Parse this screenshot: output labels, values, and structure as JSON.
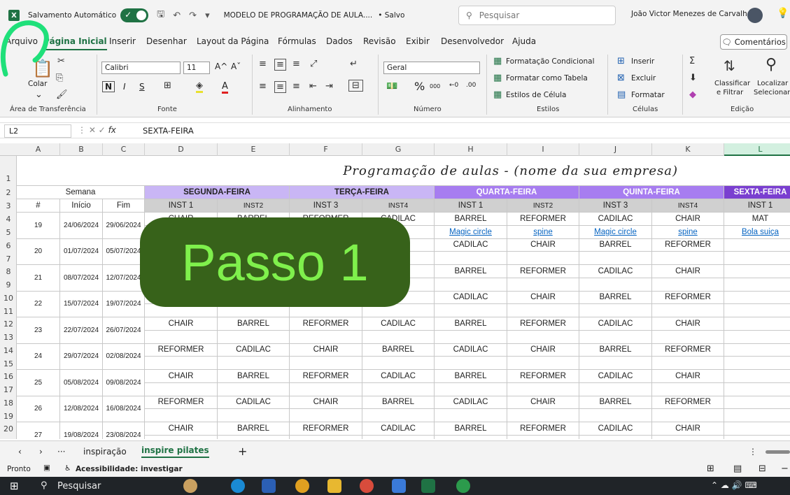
{
  "titlebar": {
    "autosave_label": "Salvamento Automático",
    "doc_title": "MODELO DE PROGRAMAÇÃO DE AULA....",
    "save_status": "• Salvo",
    "search_placeholder": "Pesquisar",
    "user_name": "João Victor Menezes de Carvalho"
  },
  "menu": {
    "tabs": [
      "Arquivo",
      "Página Inicial",
      "Inserir",
      "Desenhar",
      "Layout da Página",
      "Fórmulas",
      "Dados",
      "Revisão",
      "Exibir",
      "Desenvolvedor",
      "Ajuda"
    ],
    "active": "Página Inicial",
    "comments": "Comentários"
  },
  "ribbon": {
    "paste": "Colar",
    "clipboard_group": "Área de Transferência",
    "font_name": "Calibri",
    "font_size": "11",
    "font_group": "Fonte",
    "align_group": "Alinhamento",
    "number_format": "Geral",
    "number_group": "Número",
    "cond_format": "Formatação Condicional",
    "format_table": "Formatar como Tabela",
    "cell_styles": "Estilos de Célula",
    "styles_group": "Estilos",
    "insert": "Inserir",
    "delete": "Excluir",
    "format": "Formatar",
    "cells_group": "Células",
    "sort_1": "Classificar",
    "sort_2": "e Filtrar",
    "find_1": "Localizar",
    "find_2": "Selecionar",
    "edit_group": "Edição"
  },
  "formula_bar": {
    "cell_ref": "L2",
    "formula": "SEXTA-FEIRA"
  },
  "sheet": {
    "columns": [
      "A",
      "B",
      "C",
      "D",
      "E",
      "F",
      "G",
      "H",
      "I",
      "J",
      "K",
      "L"
    ],
    "selected_column": "L",
    "rows": [
      "1",
      "2",
      "3",
      "4",
      "5",
      "6",
      "7",
      "8",
      "9",
      "10",
      "11",
      "12",
      "13",
      "14",
      "15",
      "16",
      "17",
      "18",
      "19",
      "20"
    ],
    "title": "Programação de aulas - (nome da sua empresa)",
    "semana_header": "Semana",
    "days": [
      "SEGUNDA-FEIRA",
      "TERÇA-FEIRA",
      "QUARTA-FEIRA",
      "QUINTA-FEIRA",
      "SEXTA-FEIRA"
    ],
    "day_colors": [
      "#c9b6f5",
      "#c9b6f5",
      "#a77df0",
      "#a77df0",
      "#7a3fd0"
    ],
    "sub_headers": [
      "#",
      "Início",
      "Fim",
      "INST 1",
      "INST2",
      "INST 3",
      "INST4",
      "INST 1",
      "INST2",
      "INST 3",
      "INST4",
      "INST 1"
    ],
    "weeks": [
      {
        "num": "19",
        "start": "24/06/2024",
        "end": "29/06/2024",
        "a": [
          "CHAIR",
          "BARREL",
          "REFORMER",
          "CADILAC",
          "BARREL",
          "REFORMER",
          "CADILAC",
          "CHAIR",
          "MAT"
        ],
        "b": [
          "",
          "",
          "",
          "",
          "Magic circle",
          "spine",
          "Magic circle",
          "spine",
          "Bola suiça"
        ]
      },
      {
        "num": "20",
        "start": "01/07/2024",
        "end": "05/07/2024",
        "a": [
          "",
          "",
          "",
          "",
          "CADILAC",
          "CHAIR",
          "BARREL",
          "REFORMER",
          ""
        ],
        "b": [
          "",
          "",
          "",
          "",
          "",
          "",
          "",
          "",
          ""
        ]
      },
      {
        "num": "21",
        "start": "08/07/2024",
        "end": "12/07/2024",
        "a": [
          "",
          "",
          "",
          "",
          "BARREL",
          "REFORMER",
          "CADILAC",
          "CHAIR",
          ""
        ],
        "b": [
          "",
          "",
          "",
          "",
          "",
          "",
          "",
          "",
          ""
        ]
      },
      {
        "num": "22",
        "start": "15/07/2024",
        "end": "19/07/2024",
        "a": [
          "",
          "",
          "",
          "",
          "CADILAC",
          "CHAIR",
          "BARREL",
          "REFORMER",
          ""
        ],
        "b": [
          "",
          "",
          "",
          "",
          "",
          "",
          "",
          "",
          ""
        ]
      },
      {
        "num": "23",
        "start": "22/07/2024",
        "end": "26/07/2024",
        "a": [
          "CHAIR",
          "BARREL",
          "REFORMER",
          "CADILAC",
          "BARREL",
          "REFORMER",
          "CADILAC",
          "CHAIR",
          ""
        ],
        "b": [
          "",
          "",
          "",
          "",
          "",
          "",
          "",
          "",
          ""
        ]
      },
      {
        "num": "24",
        "start": "29/07/2024",
        "end": "02/08/2024",
        "a": [
          "REFORMER",
          "CADILAC",
          "CHAIR",
          "BARREL",
          "CADILAC",
          "CHAIR",
          "BARREL",
          "REFORMER",
          ""
        ],
        "b": [
          "",
          "",
          "",
          "",
          "",
          "",
          "",
          "",
          ""
        ]
      },
      {
        "num": "25",
        "start": "05/08/2024",
        "end": "09/08/2024",
        "a": [
          "CHAIR",
          "BARREL",
          "REFORMER",
          "CADILAC",
          "BARREL",
          "REFORMER",
          "CADILAC",
          "CHAIR",
          ""
        ],
        "b": [
          "",
          "",
          "",
          "",
          "",
          "",
          "",
          "",
          ""
        ]
      },
      {
        "num": "26",
        "start": "12/08/2024",
        "end": "16/08/2024",
        "a": [
          "REFORMER",
          "CADILAC",
          "CHAIR",
          "BARREL",
          "CADILAC",
          "CHAIR",
          "BARREL",
          "REFORMER",
          ""
        ],
        "b": [
          "",
          "",
          "",
          "",
          "",
          "",
          "",
          "",
          ""
        ]
      },
      {
        "num": "27",
        "start": "19/08/2024",
        "end": "23/08/2024",
        "a": [
          "CHAIR",
          "BARREL",
          "REFORMER",
          "CADILAC",
          "BARREL",
          "REFORMER",
          "CADILAC",
          "CHAIR",
          ""
        ],
        "b": [
          "",
          "",
          "",
          "",
          "",
          "",
          "",
          "",
          ""
        ]
      }
    ]
  },
  "overlay": {
    "text": "Passo 1"
  },
  "sheet_tabs": {
    "more": "···",
    "tab_1": "inspiração",
    "tab_2": "inspire pilates",
    "add": "+"
  },
  "status": {
    "ready": "Pronto",
    "accessibility": "Acessibilidade: investigar"
  },
  "taskbar": {
    "search": "Pesquisar"
  }
}
